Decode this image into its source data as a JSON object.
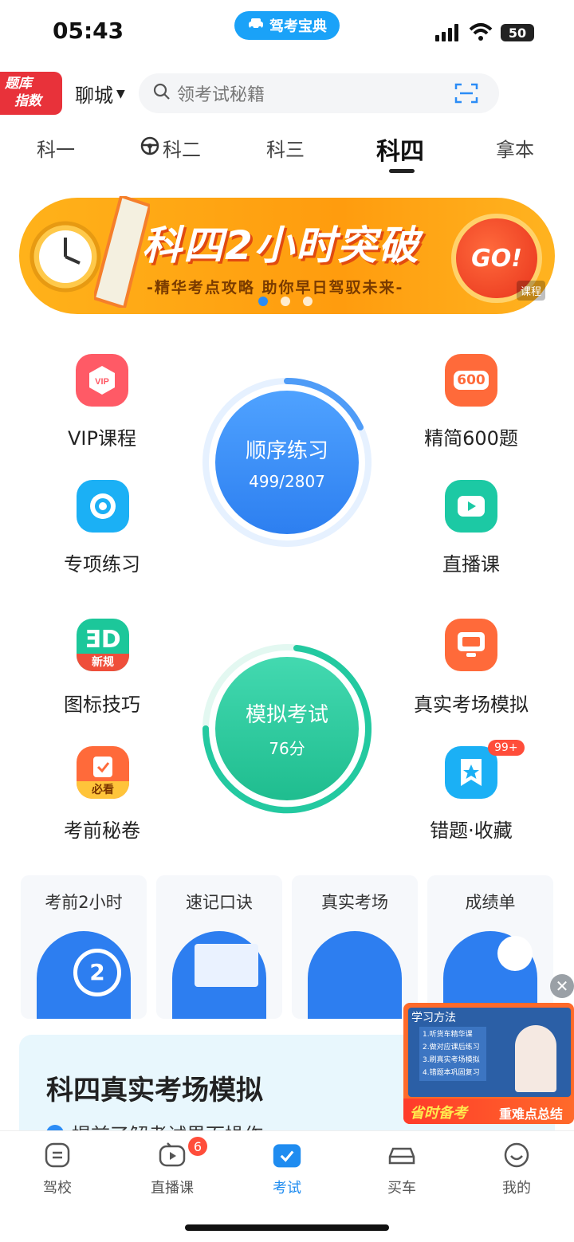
{
  "status_bar": {
    "time": "05:43",
    "app_name": "驾考宝典",
    "battery": "50"
  },
  "top_bar": {
    "badge_line1": "题库",
    "badge_line2": "指数",
    "city": "聊城",
    "search_placeholder": "领考试秘籍"
  },
  "tabs": [
    {
      "label": "科一"
    },
    {
      "label": "科二"
    },
    {
      "label": "科三"
    },
    {
      "label": "科四"
    },
    {
      "label": "拿本"
    }
  ],
  "active_tab": "科四",
  "banner": {
    "title": "科四2小时突破",
    "subtitle": "-精华考点攻略 助你早日驾驭未来-",
    "go": "GO!",
    "tag": "课程",
    "page_count": 3,
    "active_page": 1
  },
  "practice": {
    "title": "顺序练习",
    "progress": "499/2807"
  },
  "exam": {
    "title": "模拟考试",
    "score": "76分"
  },
  "features_left": [
    {
      "label": "VIP课程",
      "icon": "vip-icon",
      "icon_text": "VIP"
    },
    {
      "label": "专项练习",
      "icon": "target-icon"
    },
    {
      "label": "图标技巧",
      "icon": "sign-icon",
      "icon_tag": "新规"
    },
    {
      "label": "考前秘卷",
      "icon": "clipboard-check-icon",
      "icon_tag": "必看"
    }
  ],
  "features_right": [
    {
      "label": "精简600题",
      "icon": "count-600-icon",
      "icon_text": "600"
    },
    {
      "label": "直播课",
      "icon": "video-icon"
    },
    {
      "label": "真实考场模拟",
      "icon": "monitor-icon"
    },
    {
      "label": "错题·收藏",
      "icon": "bookmark-star-icon",
      "badge": "99+"
    }
  ],
  "tools": [
    {
      "label": "考前2小时"
    },
    {
      "label": "速记口诀"
    },
    {
      "label": "真实考场"
    },
    {
      "label": "成绩单"
    }
  ],
  "card": {
    "title": "科四真实考场模拟",
    "line": "提前了解考试界面操作"
  },
  "float_video": {
    "header": "学习方法",
    "list": [
      "1.听货车精华课",
      "2.做对应课后练习",
      "3.刷真实考场模拟",
      "4.错题本巩固复习"
    ],
    "caption_left": "省时备考",
    "caption_right": "重难点总结"
  },
  "bottom_nav": [
    {
      "label": "驾校",
      "icon": "school-icon"
    },
    {
      "label": "直播课",
      "icon": "tv-icon",
      "badge": "6"
    },
    {
      "label": "考试",
      "icon": "exam-icon",
      "active": true
    },
    {
      "label": "买车",
      "icon": "car-icon"
    },
    {
      "label": "我的",
      "icon": "smile-icon"
    }
  ],
  "colors": {
    "accent": "#1f8cf0",
    "banner": "#ff9c0e",
    "practice": "#3a8df5",
    "exam": "#22c9a0",
    "danger": "#e8323a"
  }
}
